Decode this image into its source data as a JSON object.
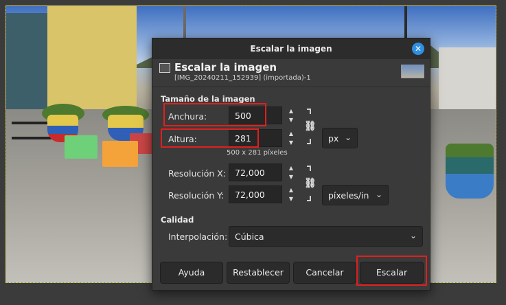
{
  "dialog": {
    "window_title": "Escalar la imagen",
    "close_glyph": "✕",
    "header_title": "Escalar la imagen",
    "header_subtitle": "[IMG_20240211_152939] (importada)-1"
  },
  "image_size": {
    "section_title": "Tamaño de la imagen",
    "width_label": "Anchura:",
    "width_value": "500",
    "height_label": "Altura:",
    "height_value": "281",
    "size_note": "500 x 281 píxeles",
    "unit": "px",
    "res_x_label": "Resolución X:",
    "res_x_value": "72,000",
    "res_y_label": "Resolución Y:",
    "res_y_value": "72,000",
    "res_unit": "píxeles/in"
  },
  "quality": {
    "section_title": "Calidad",
    "interp_label": "Interpolación:",
    "interp_value": "Cúbica"
  },
  "buttons": {
    "help": "Ayuda",
    "reset": "Restablecer",
    "cancel": "Cancelar",
    "scale": "Escalar"
  },
  "icons": {
    "chain": "chain-link-icon",
    "spin_up": "▲",
    "spin_down": "▼",
    "chevron": "chevron-down-icon",
    "highlight_color": "#e0201e",
    "accent_color": "#2f8fe0"
  }
}
